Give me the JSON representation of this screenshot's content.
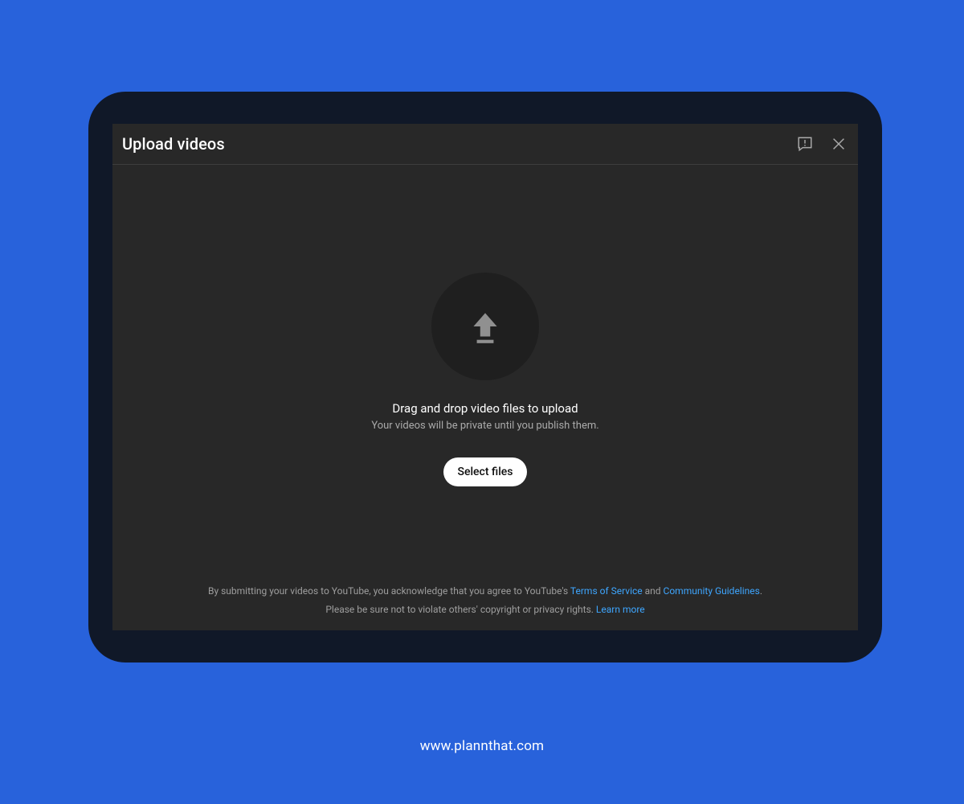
{
  "dialog": {
    "title": "Upload videos",
    "main_text": "Drag and drop video files to upload",
    "sub_text": "Your videos will be private until you publish them.",
    "select_button": "Select files"
  },
  "legal": {
    "line1_prefix": "By submitting your videos to YouTube, you acknowledge that you agree to YouTube's ",
    "tos_link": "Terms of Service",
    "line1_mid": " and ",
    "guidelines_link": "Community Guidelines",
    "line1_suffix": ".",
    "line2_prefix": "Please be sure not to violate others' copyright or privacy rights. ",
    "learn_more_link": "Learn more"
  },
  "watermark": "www.plannthat.com"
}
